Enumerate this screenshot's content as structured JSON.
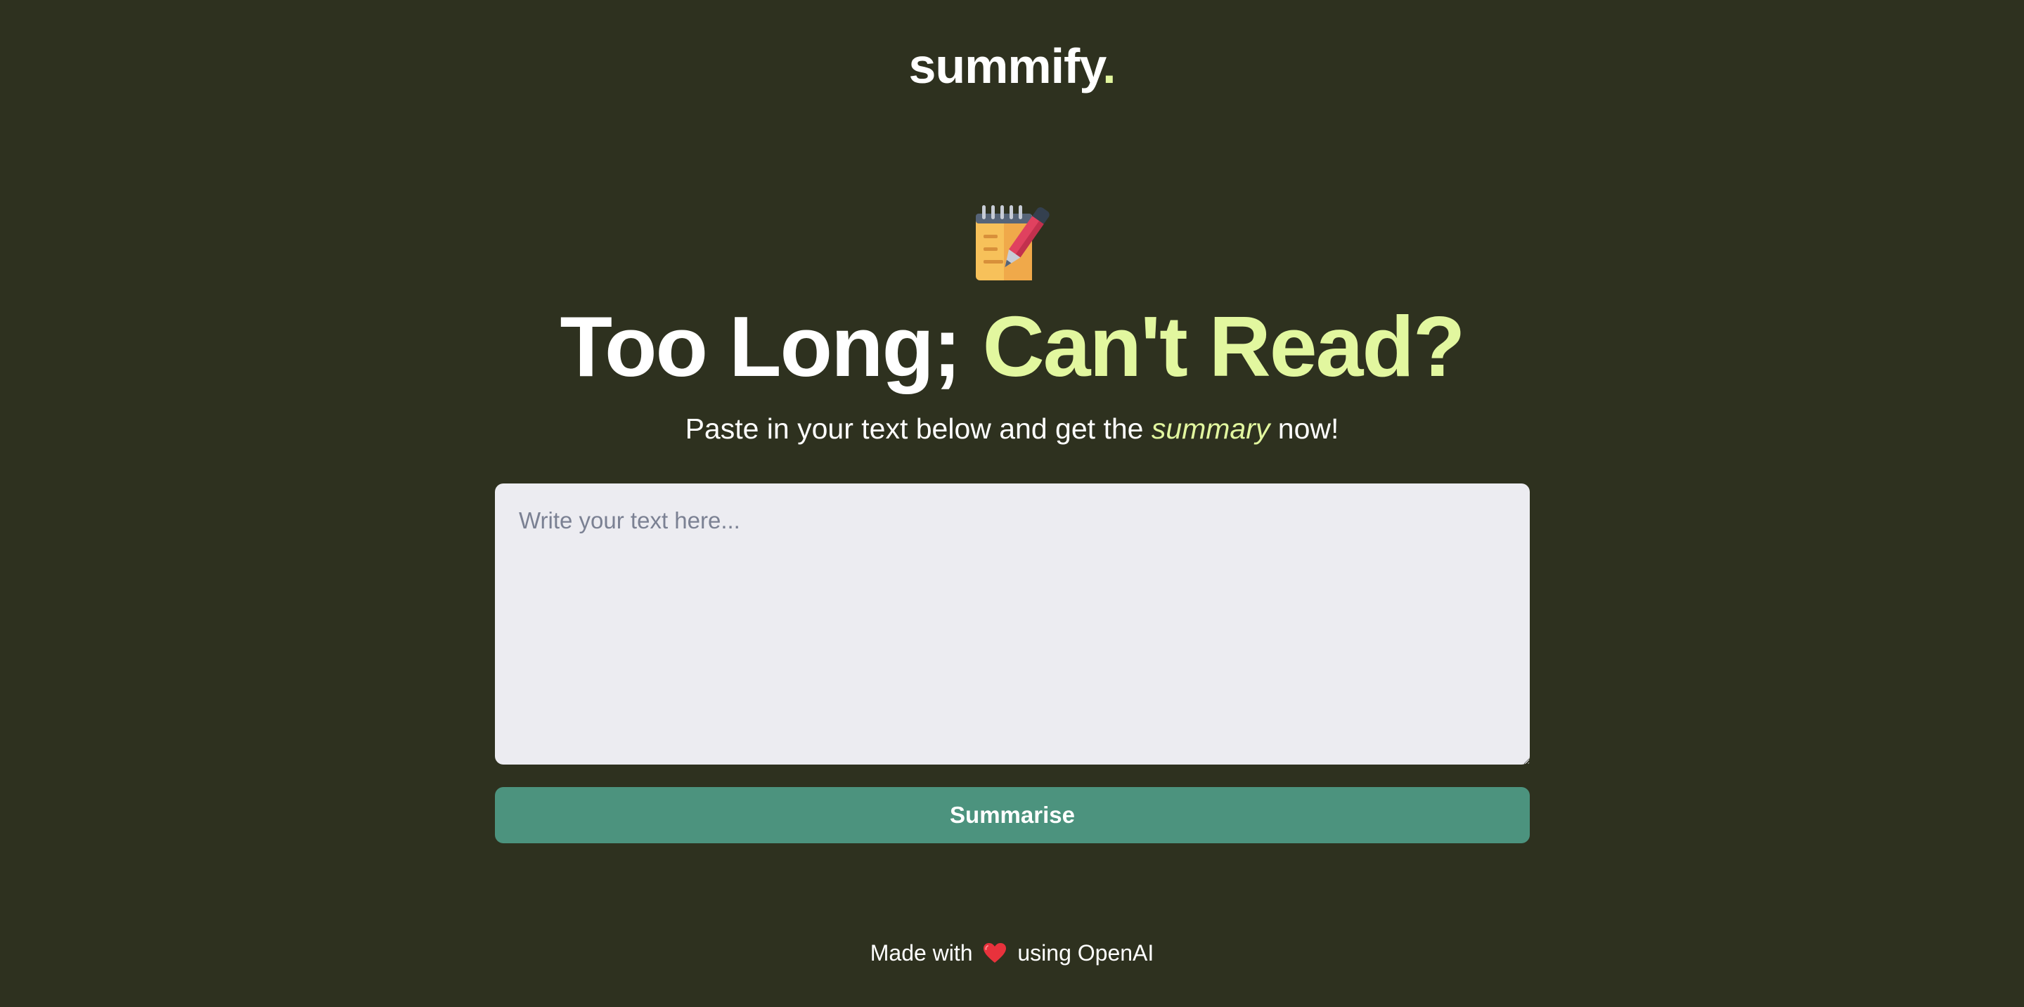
{
  "brand": {
    "name": "summify",
    "dot": "."
  },
  "hero": {
    "icon": "memo-notepad-pen-icon",
    "headline_plain": "Too Long; ",
    "headline_accent": "Can't Read?",
    "subtitle_before": "Paste in your text below and get the ",
    "subtitle_emphasis": "summary",
    "subtitle_after": " now!"
  },
  "form": {
    "placeholder": "Write your text here...",
    "value": "",
    "submit_label": "Summarise"
  },
  "footer": {
    "before": "Made with ",
    "heart_icon": "heart-icon",
    "after": " using OpenAI"
  },
  "colors": {
    "background": "#2e311f",
    "accent": "#e2f79f",
    "button": "#4c937e",
    "textarea": "#ececf1"
  }
}
